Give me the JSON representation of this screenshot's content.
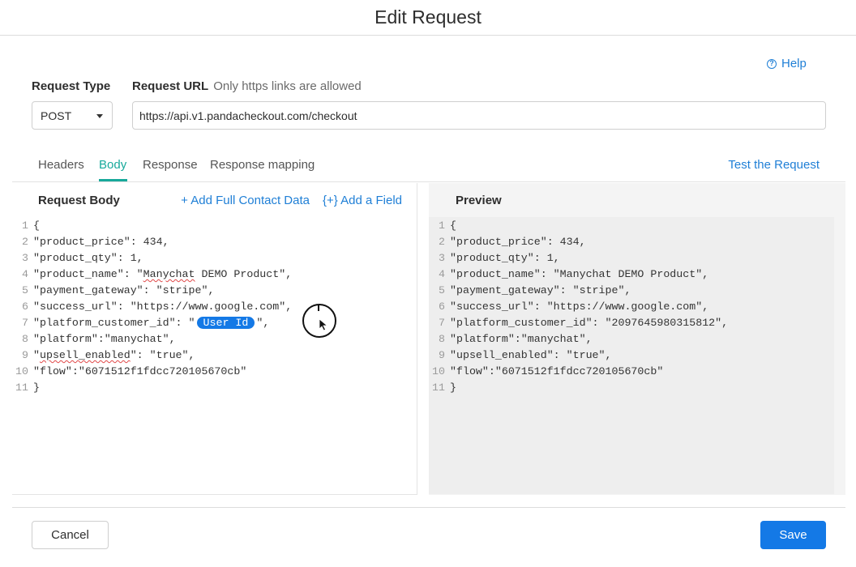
{
  "dialog": {
    "title": "Edit Request"
  },
  "help": {
    "label": "Help",
    "icon": "question-circle-icon"
  },
  "request_type": {
    "label": "Request Type",
    "value": "POST"
  },
  "request_url": {
    "label": "Request URL",
    "hint": "Only https links are allowed",
    "value": "https://api.v1.pandacheckout.com/checkout"
  },
  "tabs": [
    {
      "label": "Headers",
      "active": false
    },
    {
      "label": "Body",
      "active": true
    },
    {
      "label": "Response",
      "active": false
    },
    {
      "label": "Response mapping",
      "active": false
    }
  ],
  "test_link": "Test the Request",
  "request_body": {
    "title": "Request Body",
    "add_full_contact": "+ Add Full Contact Data",
    "add_field": "{+} Add a Field",
    "lines": [
      {
        "n": "1",
        "before": "{",
        "pill": "",
        "after": ""
      },
      {
        "n": "2",
        "before": "\"product_price\": 434,",
        "pill": "",
        "after": ""
      },
      {
        "n": "3",
        "before": "\"product_qty\": 1,",
        "pill": "",
        "after": ""
      },
      {
        "n": "4",
        "before": "\"product_name\": \"Manychat DEMO Product\",",
        "pill": "",
        "after": ""
      },
      {
        "n": "5",
        "before": "\"payment_gateway\": \"stripe\",",
        "pill": "",
        "after": ""
      },
      {
        "n": "6",
        "before": "\"success_url\": \"https://www.google.com\",",
        "pill": "",
        "after": ""
      },
      {
        "n": "7",
        "before": "\"platform_customer_id\": \"",
        "pill": "User Id",
        "after": "\","
      },
      {
        "n": "8",
        "before": "\"platform\":\"manychat\",",
        "pill": "",
        "after": ""
      },
      {
        "n": "9",
        "before": "\"upsell_enabled\": \"true\",",
        "pill": "",
        "after": ""
      },
      {
        "n": "10",
        "before": "\"flow\":\"6071512f1fdcc720105670cb\"",
        "pill": "",
        "after": ""
      },
      {
        "n": "11",
        "before": "}",
        "pill": "",
        "after": ""
      }
    ]
  },
  "preview": {
    "title": "Preview",
    "lines": [
      {
        "n": "1",
        "text": "{"
      },
      {
        "n": "2",
        "text": "\"product_price\": 434,"
      },
      {
        "n": "3",
        "text": "\"product_qty\": 1,"
      },
      {
        "n": "4",
        "text": "\"product_name\": \"Manychat DEMO Product\","
      },
      {
        "n": "5",
        "text": "\"payment_gateway\": \"stripe\","
      },
      {
        "n": "6",
        "text": "\"success_url\": \"https://www.google.com\","
      },
      {
        "n": "7",
        "text": "\"platform_customer_id\": \"2097645980315812\","
      },
      {
        "n": "8",
        "text": "\"platform\":\"manychat\","
      },
      {
        "n": "9",
        "text": "\"upsell_enabled\": \"true\","
      },
      {
        "n": "10",
        "text": "\"flow\":\"6071512f1fdcc720105670cb\""
      },
      {
        "n": "11",
        "text": "}"
      }
    ]
  },
  "footer": {
    "cancel": "Cancel",
    "save": "Save"
  },
  "colors": {
    "accent_blue": "#1479e6",
    "link_blue": "#1f7fd6",
    "active_tab": "#18a99b"
  }
}
